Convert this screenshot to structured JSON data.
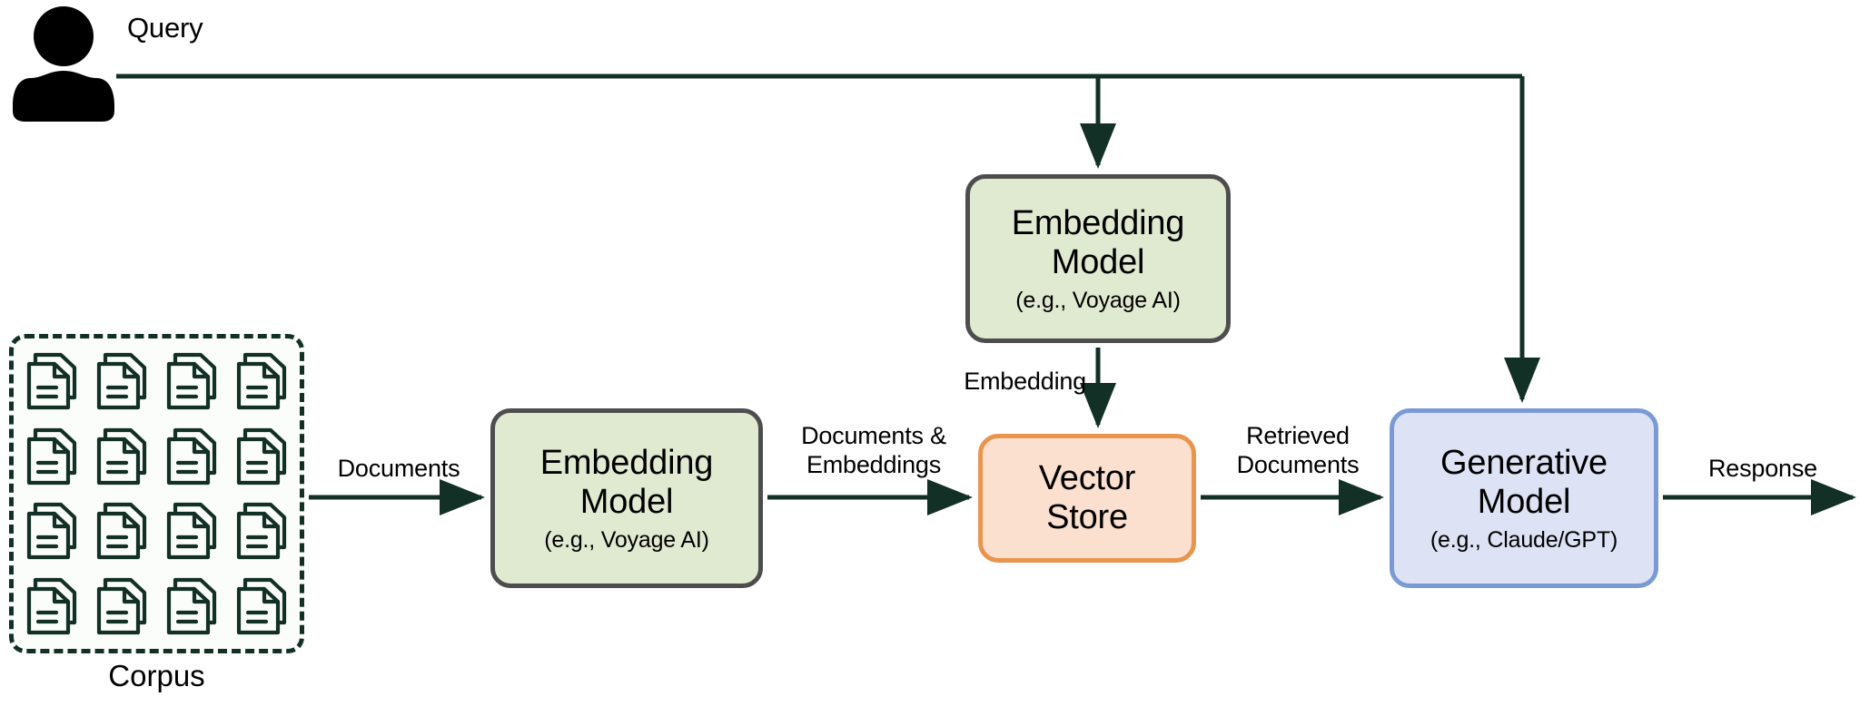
{
  "diagram": {
    "title": "Retrieval Augmented Generation pipeline",
    "colors": {
      "arrow": "#133027",
      "embedding_fill": "#dfead0",
      "embedding_border": "#4d4d4d",
      "vector_fill": "#fbe0cf",
      "vector_border": "#e8954e",
      "generative_fill": "#dde3f4",
      "generative_border": "#7a9ad6",
      "corpus_border": "#133027",
      "doc_icon": "#133027",
      "user_icon": "#000000",
      "text": "#000000",
      "background": "#ffffff"
    }
  },
  "actor": {
    "icon": "user-icon",
    "query_label": "Query"
  },
  "corpus": {
    "label": "Corpus",
    "doc_icon": "document-stack-icon",
    "rows": 4,
    "columns": 4,
    "document_count": 16
  },
  "nodes": {
    "embedding_top": {
      "title": "Embedding Model",
      "title_line1": "Embedding",
      "title_line2": "Model",
      "subtitle": "(e.g., Voyage AI)"
    },
    "embedding_main": {
      "title": "Embedding Model",
      "title_line1": "Embedding",
      "title_line2": "Model",
      "subtitle": "(e.g., Voyage AI)"
    },
    "vector_store": {
      "title": "Vector Store",
      "title_line1": "Vector",
      "title_line2": "Store",
      "subtitle": ""
    },
    "generative": {
      "title": "Generative Model",
      "title_line1": "Generative",
      "title_line2": "Model",
      "subtitle": "(e.g., Claude/GPT)"
    }
  },
  "edges": {
    "documents": "Documents",
    "documents_embeddings": "Documents &\nEmbeddings",
    "embedding": "Embedding",
    "retrieved_documents": "Retrieved\nDocuments",
    "response": "Response"
  }
}
